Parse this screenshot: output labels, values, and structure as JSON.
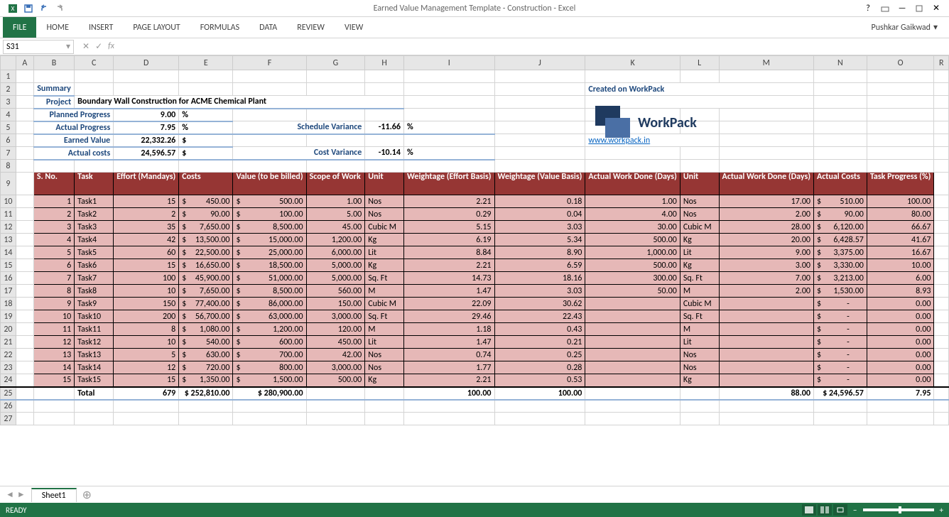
{
  "app": {
    "title": "Earned Value Management Template - Construction - Excel",
    "user": "Pushkar Gaikwad"
  },
  "tabs": {
    "file": "FILE",
    "home": "HOME",
    "insert": "INSERT",
    "pageLayout": "PAGE LAYOUT",
    "formulas": "FORMULAS",
    "data": "DATA",
    "review": "REVIEW",
    "view": "VIEW"
  },
  "nameBox": "S31",
  "cols": [
    "",
    "A",
    "B",
    "C",
    "D",
    "E",
    "F",
    "G",
    "H",
    "I",
    "J",
    "K",
    "L",
    "M",
    "N",
    "O",
    "R"
  ],
  "summary": {
    "title": "Summary",
    "projectLbl": "Project",
    "project": "Boundary Wall Construction for ACME Chemical Plant",
    "plannedLbl": "Planned Progress",
    "planned": "9.00",
    "pct": "%",
    "actualLbl": "Actual Progress",
    "actual": "7.95",
    "evLbl": "Earned Value",
    "ev": "22,332.26",
    "usd": "$",
    "acLbl": "Actual costs",
    "ac": "24,596.57",
    "svLbl": "Schedule Variance",
    "sv": "-11.66",
    "cvLbl": "Cost Variance",
    "cv": "-10.14",
    "workpack": "Created on WorkPack",
    "link": "www.workpack.in",
    "brandName": "WorkPack"
  },
  "hdr": {
    "s": "S. No.",
    "task": "Task",
    "effort": "Effort (Mandays)",
    "costs": "Costs",
    "value": "Value (to be billed)",
    "scope": "Scope of Work",
    "unit": "Unit",
    "we": "Weightage (Effort Basis)",
    "wv": "Weightage (Value Basis)",
    "awd": "Actual Work Done (Days)",
    "unit2": "Unit",
    "awdd": "Actual Work Done (Days)",
    "acosts": "Actual Costs",
    "tp": "Task Progress (%)"
  },
  "rows": [
    {
      "n": "1",
      "task": "Task1",
      "eff": "15",
      "cost": "450.00",
      "val": "500.00",
      "scope": "1.00",
      "u": "Nos",
      "we": "2.21",
      "wv": "0.18",
      "awd": "1.00",
      "u2": "Nos",
      "awdd": "17.00",
      "ac": "510.00",
      "tp": "100.00"
    },
    {
      "n": "2",
      "task": "Task2",
      "eff": "2",
      "cost": "90.00",
      "val": "100.00",
      "scope": "5.00",
      "u": "Nos",
      "we": "0.29",
      "wv": "0.04",
      "awd": "4.00",
      "u2": "Nos",
      "awdd": "2.00",
      "ac": "90.00",
      "tp": "80.00"
    },
    {
      "n": "3",
      "task": "Task3",
      "eff": "35",
      "cost": "7,650.00",
      "val": "8,500.00",
      "scope": "45.00",
      "u": "Cubic M",
      "we": "5.15",
      "wv": "3.03",
      "awd": "30.00",
      "u2": "Cubic M",
      "awdd": "28.00",
      "ac": "6,120.00",
      "tp": "66.67"
    },
    {
      "n": "4",
      "task": "Task4",
      "eff": "42",
      "cost": "13,500.00",
      "val": "15,000.00",
      "scope": "1,200.00",
      "u": "Kg",
      "we": "6.19",
      "wv": "5.34",
      "awd": "500.00",
      "u2": "Kg",
      "awdd": "20.00",
      "ac": "6,428.57",
      "tp": "41.67"
    },
    {
      "n": "5",
      "task": "Task5",
      "eff": "60",
      "cost": "22,500.00",
      "val": "25,000.00",
      "scope": "6,000.00",
      "u": "Lit",
      "we": "8.84",
      "wv": "8.90",
      "awd": "1,000.00",
      "u2": "Lit",
      "awdd": "9.00",
      "ac": "3,375.00",
      "tp": "16.67"
    },
    {
      "n": "6",
      "task": "Task6",
      "eff": "15",
      "cost": "16,650.00",
      "val": "18,500.00",
      "scope": "5,000.00",
      "u": "Kg",
      "we": "2.21",
      "wv": "6.59",
      "awd": "500.00",
      "u2": "Kg",
      "awdd": "3.00",
      "ac": "3,330.00",
      "tp": "10.00"
    },
    {
      "n": "7",
      "task": "Task7",
      "eff": "100",
      "cost": "45,900.00",
      "val": "51,000.00",
      "scope": "5,000.00",
      "u": "Sq. Ft",
      "we": "14.73",
      "wv": "18.16",
      "awd": "300.00",
      "u2": "Sq. Ft",
      "awdd": "7.00",
      "ac": "3,213.00",
      "tp": "6.00"
    },
    {
      "n": "8",
      "task": "Task8",
      "eff": "10",
      "cost": "7,650.00",
      "val": "8,500.00",
      "scope": "560.00",
      "u": "M",
      "we": "1.47",
      "wv": "3.03",
      "awd": "50.00",
      "u2": "M",
      "awdd": "2.00",
      "ac": "1,530.00",
      "tp": "8.93"
    },
    {
      "n": "9",
      "task": "Task9",
      "eff": "150",
      "cost": "77,400.00",
      "val": "86,000.00",
      "scope": "150.00",
      "u": "Cubic M",
      "we": "22.09",
      "wv": "30.62",
      "awd": "",
      "u2": "Cubic M",
      "awdd": "",
      "ac": "-",
      "tp": "0.00"
    },
    {
      "n": "10",
      "task": "Task10",
      "eff": "200",
      "cost": "56,700.00",
      "val": "63,000.00",
      "scope": "3,000.00",
      "u": "Sq. Ft",
      "we": "29.46",
      "wv": "22.43",
      "awd": "",
      "u2": "Sq. Ft",
      "awdd": "",
      "ac": "-",
      "tp": "0.00"
    },
    {
      "n": "11",
      "task": "Task11",
      "eff": "8",
      "cost": "1,080.00",
      "val": "1,200.00",
      "scope": "120.00",
      "u": "M",
      "we": "1.18",
      "wv": "0.43",
      "awd": "",
      "u2": "M",
      "awdd": "",
      "ac": "-",
      "tp": "0.00"
    },
    {
      "n": "12",
      "task": "Task12",
      "eff": "10",
      "cost": "540.00",
      "val": "600.00",
      "scope": "450.00",
      "u": "Lit",
      "we": "1.47",
      "wv": "0.21",
      "awd": "",
      "u2": "Lit",
      "awdd": "",
      "ac": "-",
      "tp": "0.00"
    },
    {
      "n": "13",
      "task": "Task13",
      "eff": "5",
      "cost": "630.00",
      "val": "700.00",
      "scope": "42.00",
      "u": "Nos",
      "we": "0.74",
      "wv": "0.25",
      "awd": "",
      "u2": "Nos",
      "awdd": "",
      "ac": "-",
      "tp": "0.00"
    },
    {
      "n": "14",
      "task": "Task14",
      "eff": "12",
      "cost": "720.00",
      "val": "800.00",
      "scope": "3,000.00",
      "u": "Nos",
      "we": "1.77",
      "wv": "0.28",
      "awd": "",
      "u2": "Nos",
      "awdd": "",
      "ac": "-",
      "tp": "0.00"
    },
    {
      "n": "15",
      "task": "Task15",
      "eff": "15",
      "cost": "1,350.00",
      "val": "1,500.00",
      "scope": "500.00",
      "u": "Kg",
      "we": "2.21",
      "wv": "0.53",
      "awd": "",
      "u2": "Kg",
      "awdd": "",
      "ac": "-",
      "tp": "0.00"
    }
  ],
  "total": {
    "lbl": "Total",
    "eff": "679",
    "cost": "$ 252,810.00",
    "val": "280,900.00",
    "we": "100.00",
    "wv": "100.00",
    "awdd": "88.00",
    "ac": "24,596.57",
    "tp": "7.95"
  },
  "sheet": "Sheet1",
  "status": "READY"
}
